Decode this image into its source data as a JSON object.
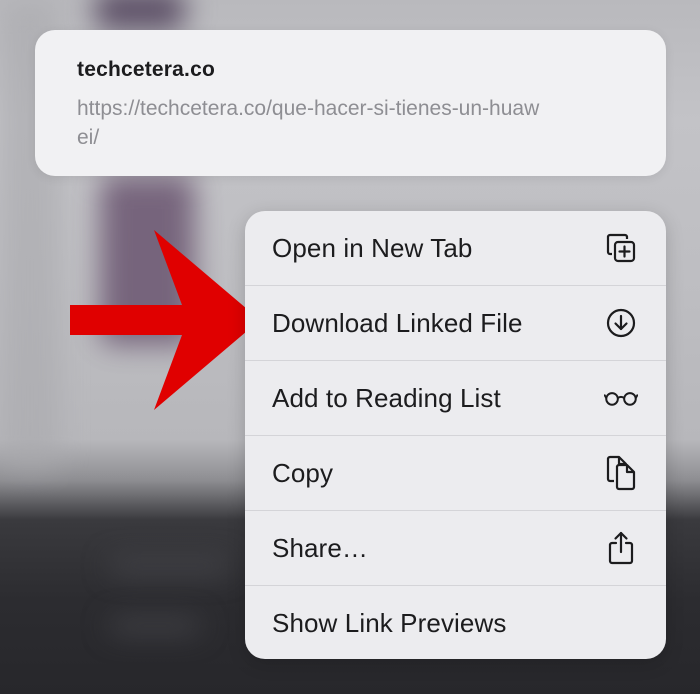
{
  "link_preview": {
    "title": "techcetera.co",
    "url": "https://techcetera.co/que-hacer-si-tienes-un-huawei/"
  },
  "context_menu": {
    "items": [
      {
        "label": "Open in New Tab",
        "icon": "plus-square-on-square-icon"
      },
      {
        "label": "Download Linked File",
        "icon": "arrow-down-circle-icon"
      },
      {
        "label": "Add to Reading List",
        "icon": "eyeglasses-icon"
      },
      {
        "label": "Copy",
        "icon": "doc-on-doc-icon"
      },
      {
        "label": "Share…",
        "icon": "share-icon"
      },
      {
        "label": "Show Link Previews",
        "icon": ""
      }
    ]
  },
  "annotation": {
    "arrow_color": "#e00000"
  },
  "colors": {
    "menu_background": "#ececef",
    "preview_background": "#f1f1f3",
    "text_primary": "#1c1c1e",
    "text_secondary": "#8e8e93"
  }
}
